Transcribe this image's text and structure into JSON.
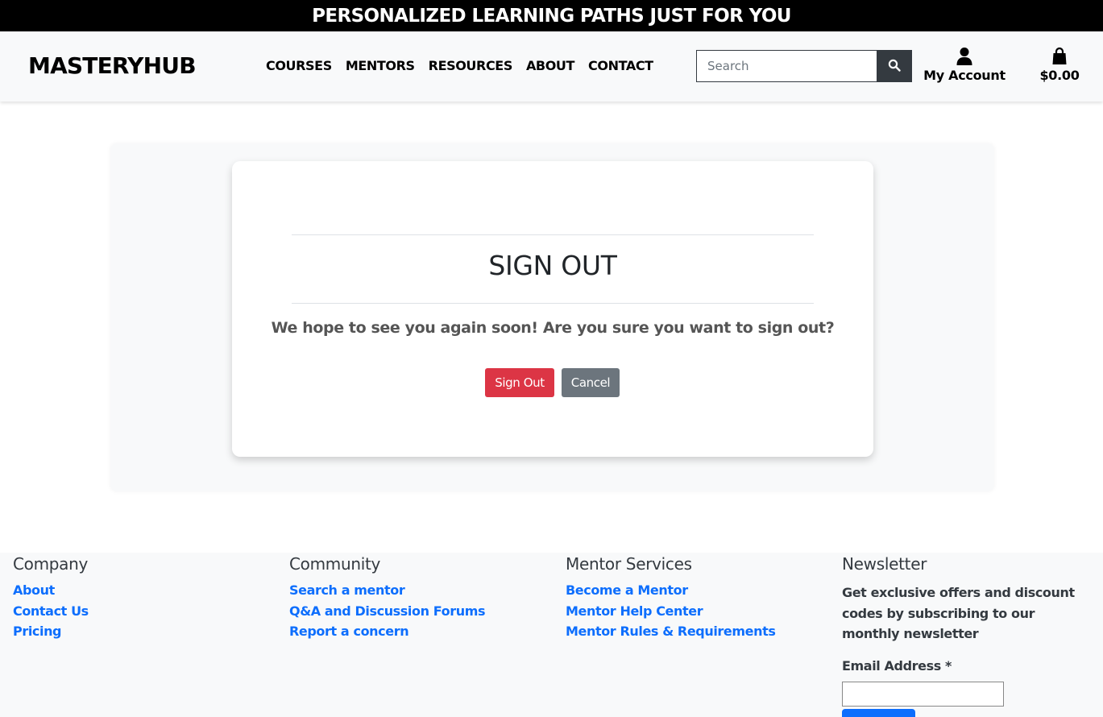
{
  "promo": {
    "text": "PERSONALIZED LEARNING PATHS JUST FOR YOU"
  },
  "header": {
    "logo": "MASTERYHUB",
    "nav": [
      "COURSES",
      "MENTORS",
      "RESOURCES",
      "ABOUT",
      "CONTACT"
    ],
    "search": {
      "placeholder": "Search",
      "icon": "search-icon"
    },
    "account": {
      "label": "My Account",
      "icon": "user-icon"
    },
    "bag": {
      "total": "$0.00",
      "icon": "shopping-bag-icon"
    }
  },
  "signout": {
    "title": "SIGN OUT",
    "message": "We hope to see you again soon! Are you sure you want to sign out?",
    "confirm_label": "Sign Out",
    "cancel_label": "Cancel"
  },
  "footer": {
    "company": {
      "heading": "Company",
      "links": [
        "About",
        "Contact Us",
        "Pricing"
      ]
    },
    "community": {
      "heading": "Community",
      "links": [
        "Search a mentor",
        "Q&A and Discussion Forums",
        "Report a concern"
      ]
    },
    "mentor": {
      "heading": "Mentor Services",
      "links": [
        "Become a Mentor",
        "Mentor Help Center",
        "Mentor Rules & Requirements"
      ]
    },
    "newsletter": {
      "heading": "Newsletter",
      "text": "Get exclusive offers and discount codes by subscribing to our monthly newsletter",
      "email_label": "Email Address *",
      "email_value": ""
    }
  },
  "colors": {
    "promo_bg": "#000000",
    "header_bg": "#f8f9fa",
    "danger": "#dc3545",
    "secondary": "#6c757d",
    "link": "#0d6efd",
    "dark": "#343a40"
  }
}
